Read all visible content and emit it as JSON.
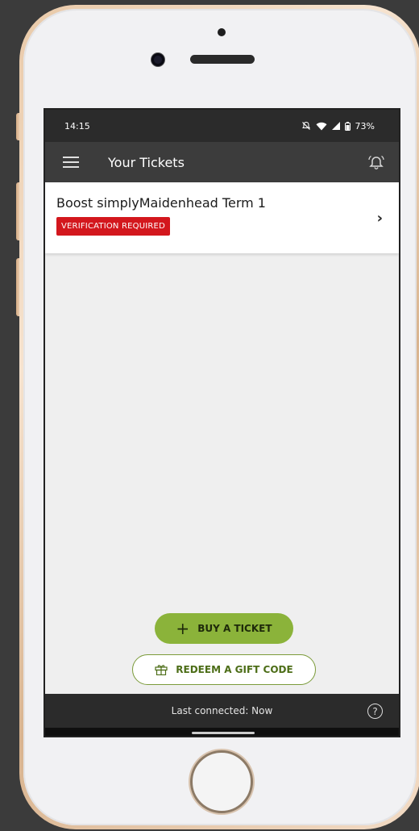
{
  "status_bar": {
    "time": "14:15",
    "battery": "73%"
  },
  "app_bar": {
    "title": "Your Tickets",
    "menu_icon": "hamburger-menu-icon",
    "notification_icon": "bell-icon"
  },
  "ticket": {
    "title": "Boost simplyMaidenhead Term 1",
    "badge": "VERIFICATION REQUIRED",
    "badge_color": "#d3171d"
  },
  "actions": {
    "buy_label": "BUY A TICKET",
    "redeem_label": "REDEEM A GIFT CODE",
    "accent": "#8bb33a"
  },
  "footer": {
    "status": "Last connected: Now",
    "help_icon": "help-icon"
  }
}
